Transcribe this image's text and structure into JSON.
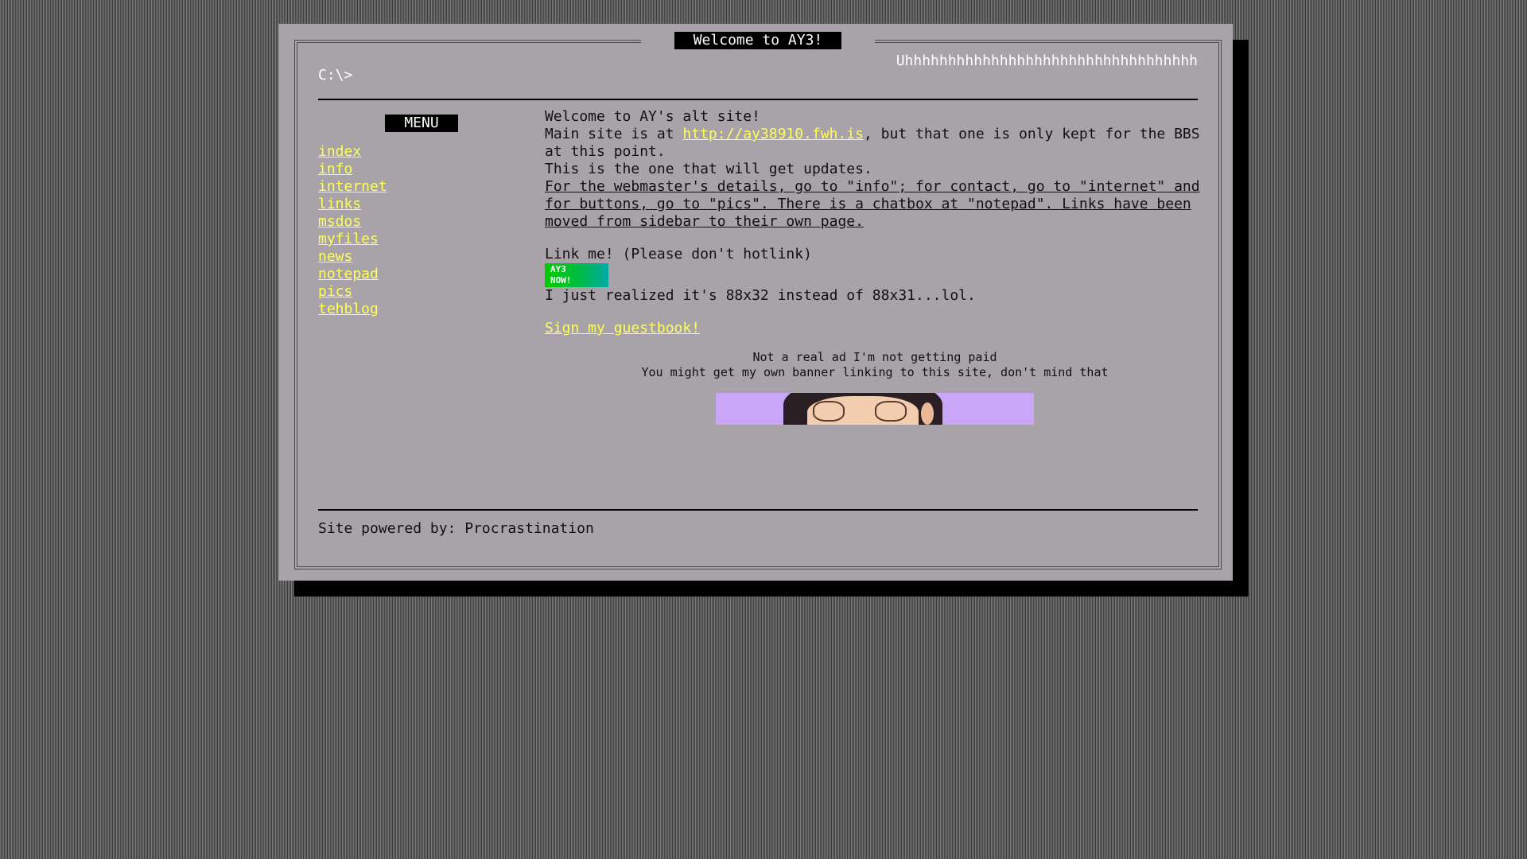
{
  "window": {
    "title": "Welcome to AY3!",
    "marquee": "Uhhhhhhhhhhhhhhhhhhhhhhhhhhhhhhhhhh",
    "prompt": "C:\\>"
  },
  "sidebar": {
    "heading": "MENU",
    "items": [
      {
        "label": "index"
      },
      {
        "label": "info"
      },
      {
        "label": "internet"
      },
      {
        "label": "links"
      },
      {
        "label": "msdos"
      },
      {
        "label": "myfiles"
      },
      {
        "label": "news"
      },
      {
        "label": "notepad"
      },
      {
        "label": "pics"
      },
      {
        "label": "tehblog"
      }
    ]
  },
  "main": {
    "welcome": "Welcome to AY's alt site!",
    "main_site_prefix": "Main site is at ",
    "main_site_link": "http://ay38910.fwh.is",
    "main_site_suffix": ", but that one is only kept for the BBS at this point.",
    "updates": "This is the one that will get updates.",
    "details": "For the webmaster's details, go to \"info\"; for contact, go to \"internet\" and for buttons, go to \"pics\". There is a chatbox at \"notepad\". Links have been moved from sidebar to their own page.",
    "link_me": "Link me! (Please don't hotlink)",
    "badge_line1": "AY3",
    "badge_line2": "NOW!",
    "realized": "I just realized it's 88x32 instead of 88x31...lol.",
    "guestbook": "Sign my guestbook!",
    "ad_line1": "Not a real ad I'm not getting paid",
    "ad_line2": "You might get my own banner linking to this site, don't mind that"
  },
  "footer": {
    "text": "Site powered by: Procrastination"
  },
  "colors": {
    "link": "#ffff55",
    "window_bg": "#a8a3a8",
    "banner_bg": "#c9a6f7"
  }
}
